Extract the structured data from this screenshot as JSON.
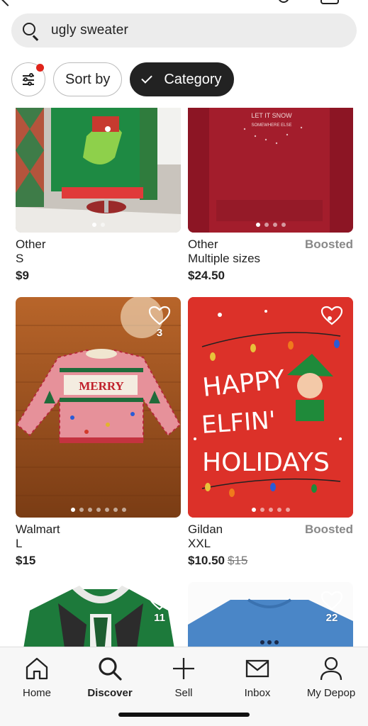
{
  "search": {
    "query": "ugly sweater"
  },
  "chips": {
    "sort_label": "Sort by",
    "category_label": "Category"
  },
  "products": [
    {
      "brand": "Other",
      "size": "S",
      "price": "$9",
      "original_price": "",
      "boosted": "",
      "likes": "",
      "dots": 2,
      "active_dot": 0
    },
    {
      "brand": "Other",
      "size": "Multiple sizes",
      "price": "$24.50",
      "original_price": "",
      "boosted": "Boosted",
      "likes": "",
      "dots": 4,
      "active_dot": 0
    },
    {
      "brand": "Walmart",
      "size": "L",
      "price": "$15",
      "original_price": "",
      "boosted": "",
      "likes": "3",
      "dots": 7,
      "active_dot": 0,
      "image_text": "MERRY"
    },
    {
      "brand": "Gildan",
      "size": "XXL",
      "price": "$10.50",
      "original_price": "$15",
      "boosted": "Boosted",
      "likes": "",
      "dots": 5,
      "active_dot": 0,
      "image_text": "HAPPY ELFIN' HOLIDAYS"
    },
    {
      "likes": "11"
    },
    {
      "likes": "22"
    }
  ],
  "nav": {
    "home": "Home",
    "discover": "Discover",
    "sell": "Sell",
    "inbox": "Inbox",
    "my_depop": "My Depop"
  },
  "colors": {
    "accent": "#222222",
    "badge_red": "#e0241b",
    "boosted_gray": "#888888"
  }
}
